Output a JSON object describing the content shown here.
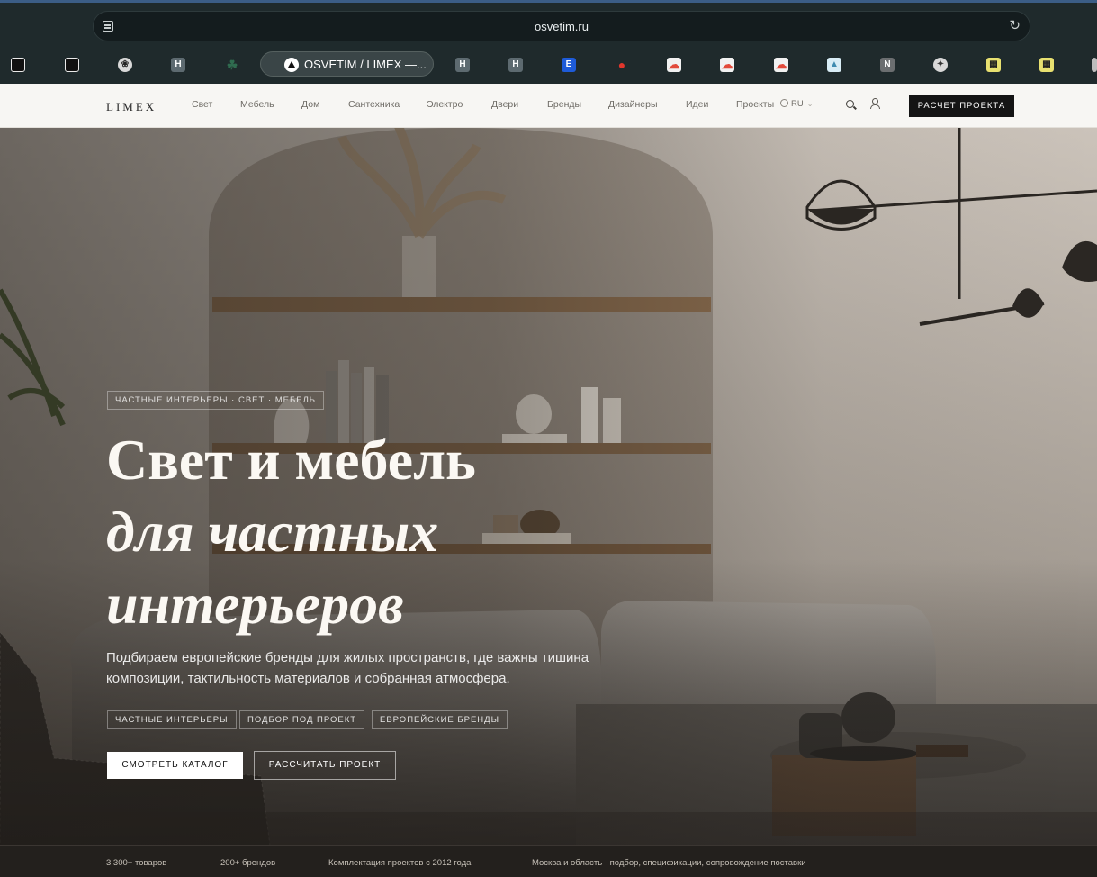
{
  "browser": {
    "url": "osvetim.ru",
    "active_tab_title": "OSVETIM / LIMEX —...",
    "tab_favicons": [
      {
        "icon": "share-icon",
        "letter": "",
        "color": "#e9e9e9"
      },
      {
        "icon": "share-icon",
        "letter": "",
        "color": "#e9e9e9"
      },
      {
        "icon": "openai-icon",
        "letter": "",
        "color": "#d9d9d9"
      },
      {
        "icon": "h-letter-icon",
        "letter": "H",
        "color": "#5d6a70"
      },
      {
        "icon": "leaf-icon",
        "letter": "",
        "color": "#2f6b4f"
      },
      {
        "icon": "h-letter-icon",
        "letter": "H",
        "color": "#5d6a70"
      },
      {
        "icon": "h-letter-icon",
        "letter": "H",
        "color": "#5d6a70"
      },
      {
        "icon": "e-letter-icon",
        "letter": "E",
        "color": "#1e5bd8"
      },
      {
        "icon": "map-pin-icon",
        "letter": "",
        "color": "#e0362c"
      },
      {
        "icon": "cloud-icon",
        "letter": "",
        "color": "#e24a3b"
      },
      {
        "icon": "cloud-icon",
        "letter": "",
        "color": "#e24a3b"
      },
      {
        "icon": "cloud-icon",
        "letter": "",
        "color": "#e24a3b"
      },
      {
        "icon": "landscape-icon",
        "letter": "",
        "color": "#6aa9c9"
      },
      {
        "icon": "n-letter-icon",
        "letter": "N",
        "color": "#6b6e70"
      },
      {
        "icon": "crest-icon",
        "letter": "",
        "color": "#d8d8d8"
      },
      {
        "icon": "grid-icon",
        "letter": "",
        "color": "#e8e070"
      },
      {
        "icon": "grid-icon",
        "letter": "",
        "color": "#e8e070"
      }
    ]
  },
  "site": {
    "logo": "LIMEX",
    "nav": [
      "Свет",
      "Мебель",
      "Дом",
      "Сантехника",
      "Электро",
      "Двери",
      "Бренды",
      "Дизайнеры",
      "Идеи",
      "Проекты"
    ],
    "lang": "RU",
    "cta": "РАСЧЕТ ПРОЕКТА"
  },
  "hero": {
    "eyebrow": "ЧАСТНЫЕ ИНТЕРЬЕРЫ · СВЕТ · МЕБЕЛЬ",
    "headline": [
      "Свет и мебель",
      "для частных",
      "интерьеров"
    ],
    "lead": "Подбираем европейские бренды для жилых пространств, где важны тишина композиции, тактильность материалов и собранная атмосфера.",
    "chips": [
      "ЧАСТНЫЕ ИНТЕРЬЕРЫ",
      "ПОДБОР ПОД ПРОЕКТ",
      "ЕВРОПЕЙСКИЕ БРЕНДЫ"
    ],
    "primary_button": "СМОТРЕТЬ КАТАЛОГ",
    "secondary_button": "РАССЧИТАТЬ ПРОЕКТ"
  },
  "stats": [
    "3 300+ товаров",
    "200+ брендов",
    "Комплектация проектов с 2012 года",
    "Москва и область · подбор, спецификации, сопровождение поставки"
  ],
  "stats_separator": "·"
}
